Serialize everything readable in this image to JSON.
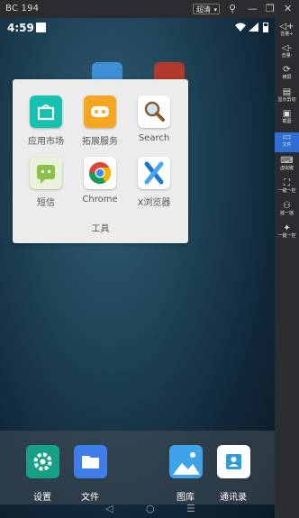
{
  "titlebar": {
    "title": "BC 194",
    "quality": "超清",
    "icons": [
      "chevron-down-icon",
      "pin-icon",
      "minimize-icon",
      "restore-icon",
      "close-icon"
    ]
  },
  "statusbar": {
    "time": "4:59"
  },
  "folder": {
    "name": "工具",
    "apps": [
      {
        "label": "应用市场",
        "icon": "app-market-icon",
        "color": "#16c1b2"
      },
      {
        "label": "拓展服务",
        "icon": "gamepad-icon",
        "color": "#f6a61f"
      },
      {
        "label": "Search",
        "icon": "magnifier-icon",
        "color": "#ffffff"
      },
      {
        "label": "短信",
        "icon": "sms-icon",
        "color": "#8bc34a"
      },
      {
        "label": "Chrome",
        "icon": "chrome-icon",
        "color": "#ffffff"
      },
      {
        "label": "X浏览器",
        "icon": "x-browser-icon",
        "color": "#ffffff"
      }
    ]
  },
  "dock": {
    "apps": [
      {
        "label": "设置",
        "icon": "gear-icon",
        "color": "#16a085"
      },
      {
        "label": "文件",
        "icon": "folder-icon",
        "color": "#3f7ee8"
      },
      {
        "label": "图库",
        "icon": "gallery-icon",
        "color": "#3ea3e8"
      },
      {
        "label": "通讯录",
        "icon": "contacts-icon",
        "color": "#2d9cdb"
      }
    ]
  },
  "navbar": [
    "back-icon",
    "home-icon",
    "menu-icon"
  ],
  "sidebar": [
    {
      "label": "音量+",
      "icon": "volume-up-icon"
    },
    {
      "label": "音量-",
      "icon": "volume-down-icon"
    },
    {
      "label": "横屏",
      "icon": "rotate-icon"
    },
    {
      "label": "显示剪切",
      "icon": "clipboard-icon"
    },
    {
      "label": "截图",
      "icon": "screenshot-icon"
    },
    {
      "label": "文件",
      "icon": "file-icon",
      "active": true
    },
    {
      "label": "虚拟键",
      "icon": "keyboard-icon"
    },
    {
      "label": "一键一控",
      "icon": "fullscreen-icon"
    },
    {
      "label": "摇一摇",
      "icon": "shake-icon"
    },
    {
      "label": "一键一控",
      "icon": "control-icon"
    }
  ]
}
